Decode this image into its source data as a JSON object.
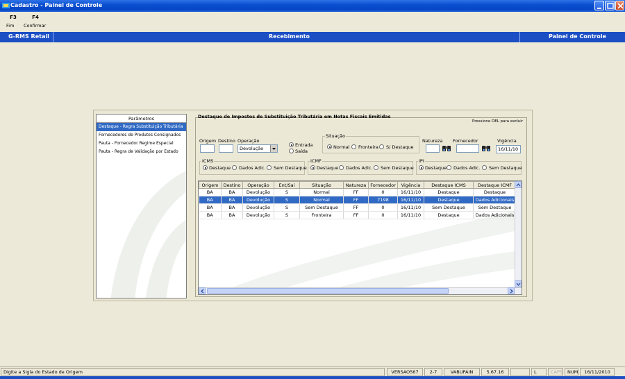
{
  "window": {
    "title": "Cadastro - Painel de Controle"
  },
  "toolbar": {
    "items": [
      {
        "key": "F3",
        "label": "Fim"
      },
      {
        "key": "F4",
        "label": "Confirmar"
      }
    ]
  },
  "header": {
    "left": "G-RMS Retail",
    "center": "Recebimento",
    "right": "Painel de Controle"
  },
  "params": {
    "title": "Parâmetros",
    "items": [
      "Destaque - Regra Substituição Tributária",
      "Fornecedores de Produtos Consignados",
      "Pauta - Fornecedor Regime Especial",
      "Pauta - Regra de Validação por Estado"
    ]
  },
  "section": {
    "title": "Destaque de Impostos de Substituição Tributária em Notas Fiscais Emitidas",
    "hint": "Pressione DEL para excluir"
  },
  "form": {
    "origem_label": "Origem",
    "destino_label": "Destino",
    "operacao_label": "Operação",
    "operacao_value": "Devolução",
    "entrada_label": "Entrada",
    "saida_label": "Saída",
    "situacao_title": "Situação",
    "situacao_normal": "Normal",
    "situacao_fronteira": "Fronteira",
    "situacao_sdestaque": "S/ Destaque",
    "natureza_label": "Natureza",
    "fornecedor_label": "Fornecedor",
    "vigencia_label": "Vigência",
    "vigencia_value": "16/11/10",
    "icms_title": "ICMS",
    "icmf_title": "ICMF",
    "ipi_title": "IPI",
    "opt_destaque": "Destaque",
    "opt_dados": "Dados Adic.",
    "opt_sem": "Sem Destaque"
  },
  "grid": {
    "columns": [
      "Origem",
      "Destino",
      "Operação",
      "Ent/Sai",
      "Situação",
      "Natureza",
      "Fornecedor",
      "Vigência",
      "Destaque ICMS",
      "Destaque ICMF"
    ],
    "rows": [
      [
        "BA",
        "BA",
        "Devolução",
        "S",
        "Normal",
        "FF",
        "0",
        "16/11/10",
        "Destaque",
        "Destaque"
      ],
      [
        "BA",
        "BA",
        "Devolução",
        "S",
        "Normal",
        "FF",
        "7198",
        "16/11/10",
        "Destaque",
        "Dados Adicionais"
      ],
      [
        "BA",
        "BA",
        "Devolução",
        "S",
        "Sem Destaque",
        "FF",
        "0",
        "16/11/10",
        "Sem Destaque",
        "Sem Destaque"
      ],
      [
        "BA",
        "BA",
        "Devolução",
        "S",
        "Fronteira",
        "FF",
        "0",
        "16/11/10",
        "Destaque",
        "Dados Adicionais"
      ]
    ],
    "selected_row": 1
  },
  "status": {
    "message": "Digite a Sigla do Estado de Origem",
    "version": "VERSAO567",
    "code": "2-7",
    "user": "VABUPAIN",
    "build": "5.67.16",
    "l": "L",
    "caps": "CAPS",
    "num": "NUM",
    "date": "16/11/2010"
  }
}
